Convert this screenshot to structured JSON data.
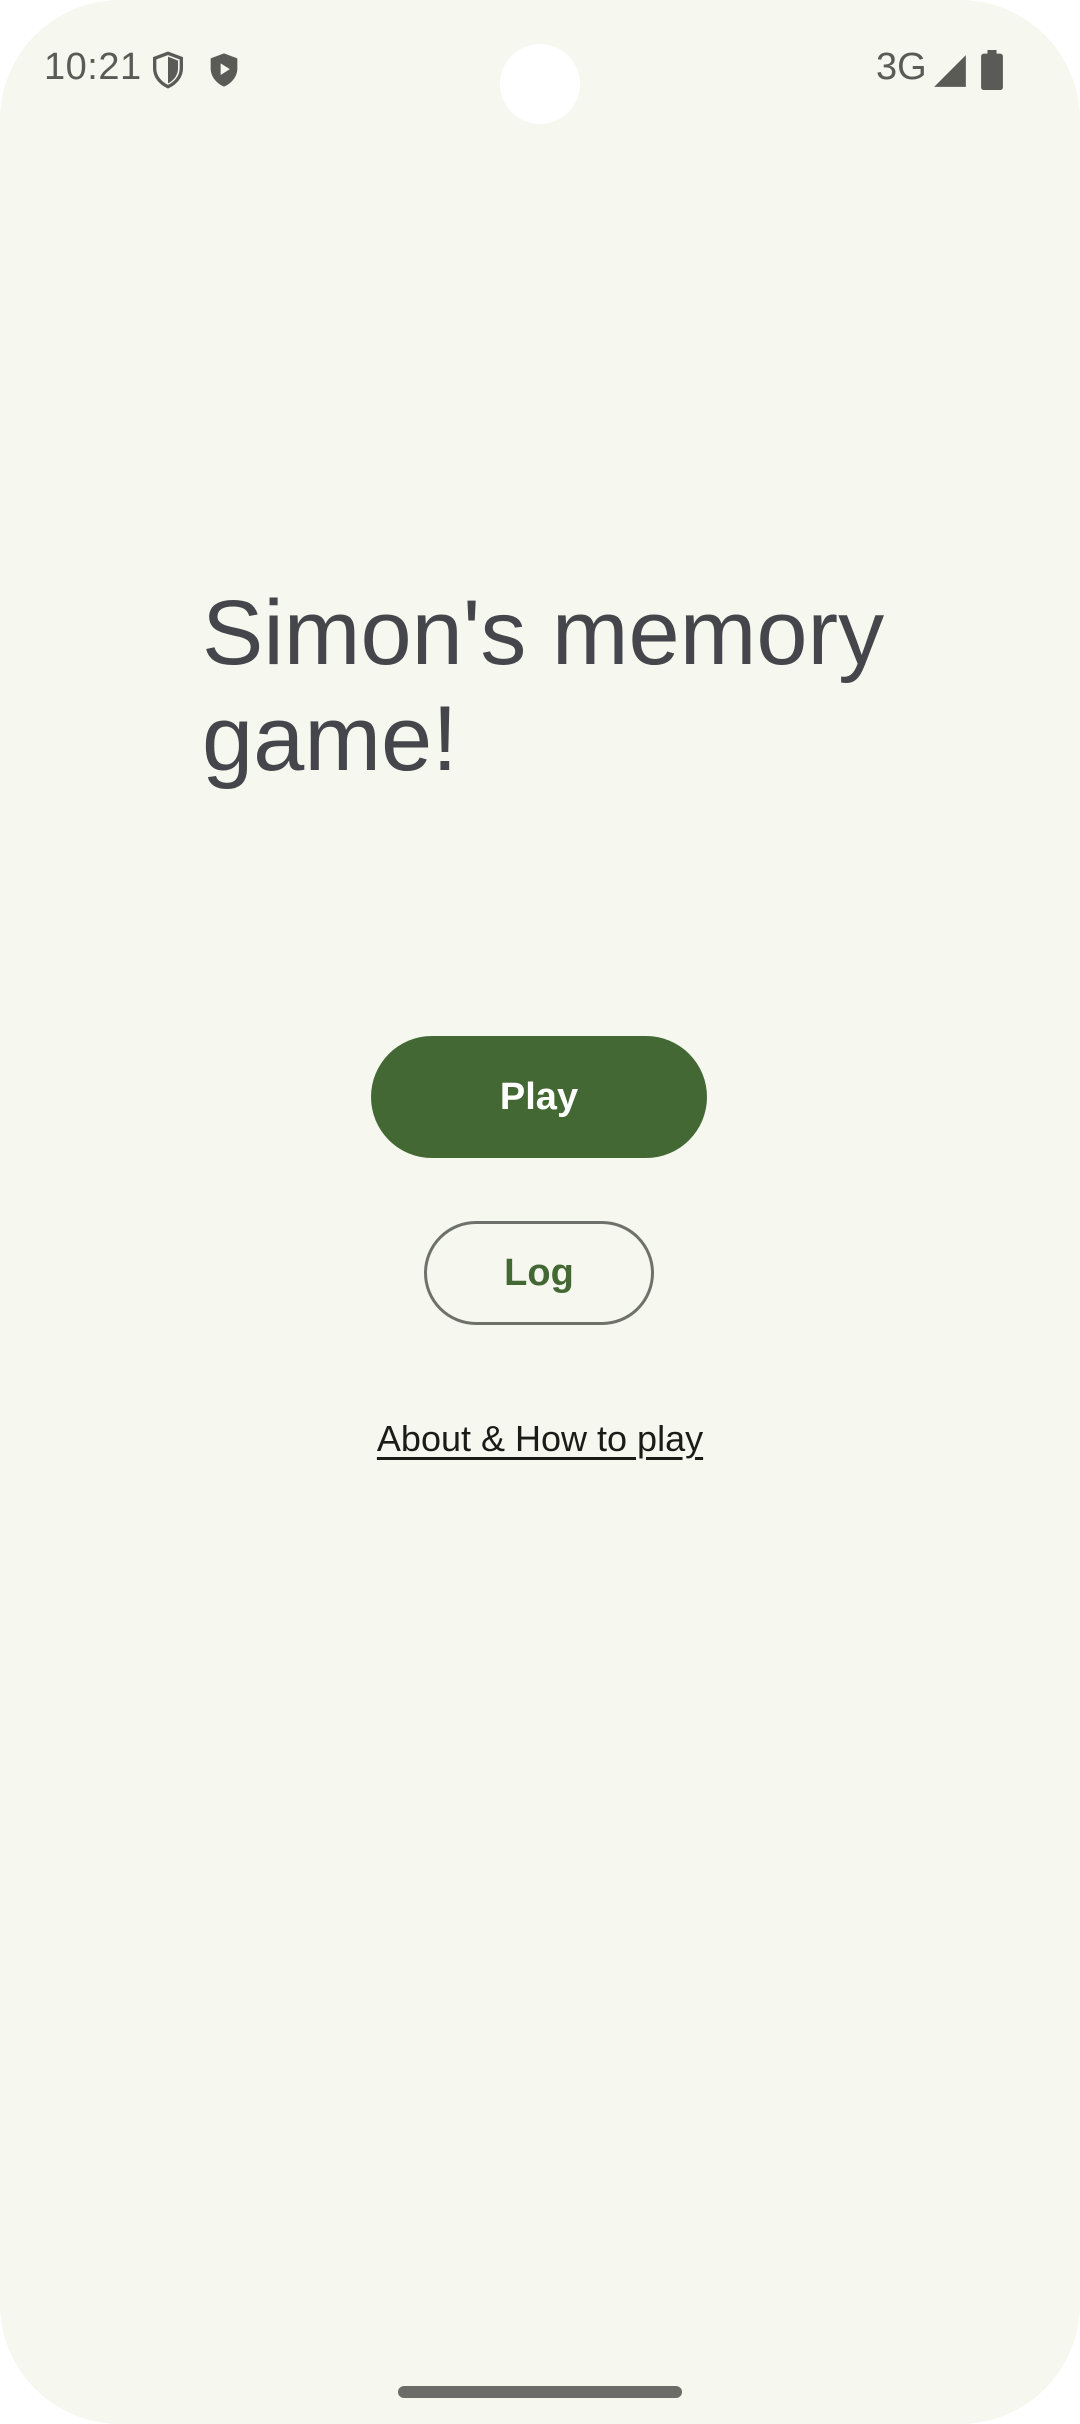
{
  "status_bar": {
    "time": "10:21",
    "network": "3G",
    "icons": [
      "shield-outline-icon",
      "play-shield-icon",
      "signal-icon",
      "battery-icon"
    ]
  },
  "main": {
    "title": "Simon's memory game!",
    "play_label": "Play",
    "log_label": "Log",
    "about_label": "About & How to play"
  },
  "colors": {
    "background": "#f6f7ee",
    "primary": "#436834",
    "title_text": "#45464b",
    "outline": "#6f716b"
  }
}
